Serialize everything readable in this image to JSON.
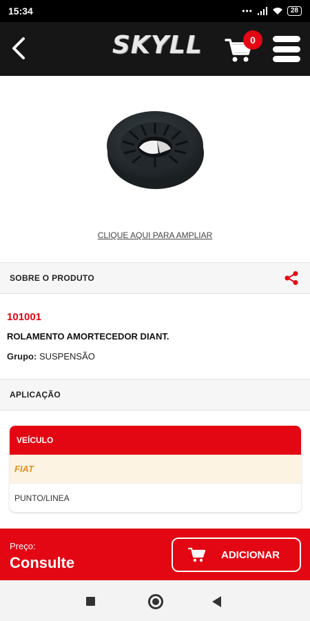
{
  "status_bar": {
    "time": "15:34",
    "battery": "28"
  },
  "header": {
    "logo_text": "SKYLL",
    "logo_subtitle": "",
    "cart_count": "0"
  },
  "product": {
    "zoom_link": "CLIQUE AQUI PARA AMPLIAR",
    "code": "101001",
    "name": "ROLAMENTO AMORTECEDOR DIANT.",
    "group_label": "Grupo:",
    "group_value": "SUSPENSÃO"
  },
  "sections": {
    "about": "SOBRE O PRODUTO",
    "application": "APLICAÇÃO"
  },
  "application_table": {
    "header": "VEÍCULO",
    "brand": "FIAT",
    "model": "PUNTO/LINEA"
  },
  "bottom_bar": {
    "price_label": "Preço:",
    "price_value": "Consulte",
    "add_label": "ADICIONAR"
  },
  "colors": {
    "accent": "#e30613",
    "header_bg": "#161616",
    "brand_text": "#e0931a",
    "brand_row_bg": "#fdf3e3"
  },
  "icons": [
    "back-arrow-icon",
    "cart-icon",
    "hamburger-menu-icon",
    "share-icon",
    "cart-add-icon",
    "nav-recent-icon",
    "nav-home-icon",
    "nav-back-icon"
  ]
}
